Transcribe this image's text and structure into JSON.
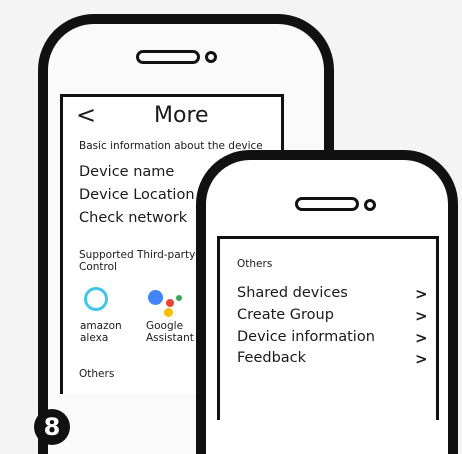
{
  "back_screen": {
    "back_arrow": "<",
    "title": "More",
    "section_basic": "Basic information about the device",
    "items": [
      "Device name",
      "Device Location",
      "Check network"
    ],
    "section_third_party_line1": "Supported Third-party",
    "section_third_party_line2": "Control",
    "alexa": {
      "line1": "amazon",
      "line2": "alexa",
      "icon": "alexa-icon",
      "color": "#3ec7e8"
    },
    "google": {
      "line1": "Google",
      "line2": "Assistant",
      "icon": "google-assistant-icon",
      "colors": {
        "blue": "#4285f4",
        "red": "#ea4335",
        "yellow": "#fbbc05",
        "green": "#34a853"
      }
    },
    "section_others": "Others"
  },
  "front_screen": {
    "section_others": "Others",
    "items": [
      {
        "label": "Shared devices",
        "chevron": ">"
      },
      {
        "label": "Create Group",
        "chevron": ">"
      },
      {
        "label": "Device information",
        "chevron": ">"
      },
      {
        "label": "Feedback",
        "chevron": ">"
      }
    ]
  },
  "step_number": "8"
}
